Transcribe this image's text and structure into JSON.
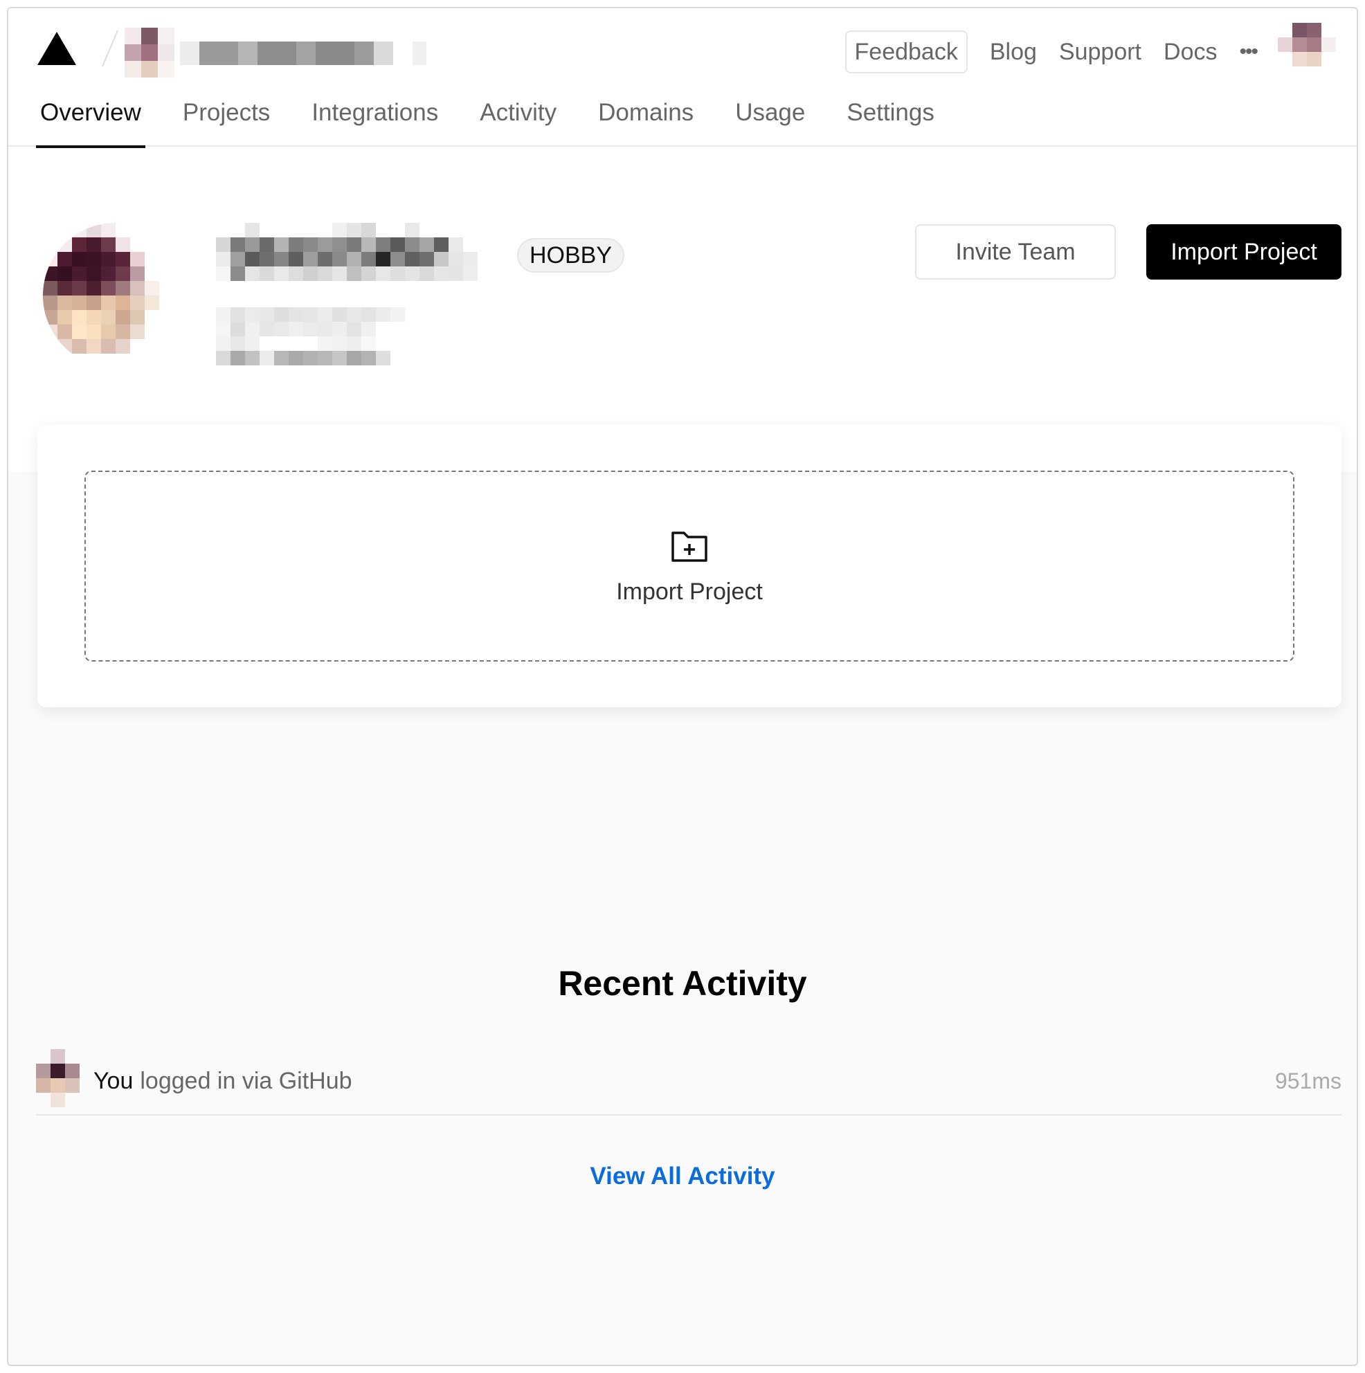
{
  "header": {
    "links": [
      "Feedback",
      "Blog",
      "Support",
      "Docs"
    ],
    "feedback_label": "Feedback",
    "blog_label": "Blog",
    "support_label": "Support",
    "docs_label": "Docs",
    "more_label": "•••"
  },
  "tabs": [
    {
      "label": "Overview",
      "active": true
    },
    {
      "label": "Projects",
      "active": false
    },
    {
      "label": "Integrations",
      "active": false
    },
    {
      "label": "Activity",
      "active": false
    },
    {
      "label": "Domains",
      "active": false
    },
    {
      "label": "Usage",
      "active": false
    },
    {
      "label": "Settings",
      "active": false
    }
  ],
  "profile": {
    "plan": "HOBBY",
    "invite_label": "Invite Team",
    "import_label": "Import Project"
  },
  "import_card": {
    "label": "Import Project"
  },
  "recent_activity": {
    "title": "Recent Activity",
    "items": [
      {
        "actor": "You",
        "text": "logged in via GitHub",
        "time": "951ms"
      }
    ],
    "view_all_label": "View All Activity"
  },
  "colors": {
    "accent_link": "#0b6ce0",
    "primary_button": "#000000",
    "background": "#fafafa"
  }
}
